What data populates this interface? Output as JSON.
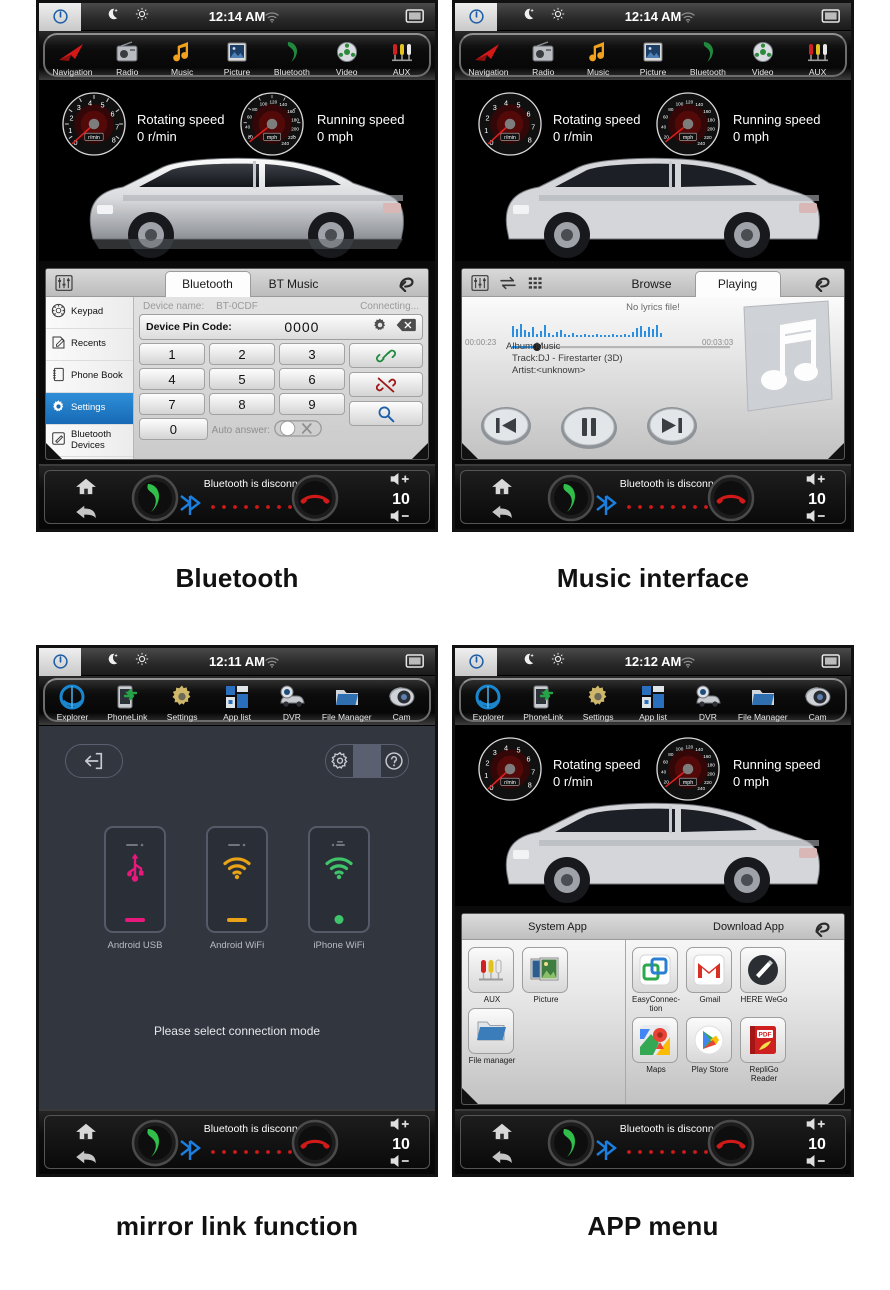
{
  "panels": [
    {
      "id": "bluetooth",
      "caption": "Bluetooth",
      "status": {
        "time": "12:14 AM",
        "power_icon": "power-icon",
        "moon_icon": "moon-icon",
        "brightness_icon": "brightness-icon",
        "wifi_icon": "wifi-icon",
        "display_icon": "display-icon"
      },
      "dock": [
        {
          "label": "Navigation",
          "icon": "navigation-icon"
        },
        {
          "label": "Radio",
          "icon": "radio-icon"
        },
        {
          "label": "Music",
          "icon": "music-note-icon"
        },
        {
          "label": "Picture",
          "icon": "picture-icon"
        },
        {
          "label": "Bluetooth",
          "icon": "bluetooth-phone-icon"
        },
        {
          "label": "Video",
          "icon": "video-icon"
        },
        {
          "label": "AUX",
          "icon": "aux-icon"
        }
      ],
      "gauges": {
        "tach_label": "Rotating speed",
        "tach_value": "0 r/min",
        "tach_unit": "r/min",
        "speedo_label": "Running speed",
        "speedo_value": "0 mph",
        "speedo_unit": "mph",
        "tach_ticks": [
          "0",
          "1",
          "2",
          "3",
          "4",
          "5",
          "6",
          "7",
          "8"
        ],
        "speedo_ticks": [
          "20",
          "40",
          "60",
          "80",
          "100",
          "120",
          "140",
          "160",
          "180",
          "200",
          "220",
          "240"
        ]
      },
      "overlay": {
        "tabs": [
          {
            "label": "Bluetooth",
            "active": true
          },
          {
            "label": "BT Music",
            "active": false
          }
        ],
        "tool_icon": "equalizer-icon",
        "back_icon": "back-arrow-icon",
        "sidebar": [
          {
            "label": "Keypad",
            "icon": "dialpad-icon",
            "selected": false
          },
          {
            "label": "Recents",
            "icon": "recents-icon",
            "selected": false
          },
          {
            "label": "Phone Book",
            "icon": "phonebook-icon",
            "selected": false
          },
          {
            "label": "Settings",
            "icon": "gear-icon",
            "selected": true
          },
          {
            "label": "Bluetooth Devices",
            "icon": "bt-devices-icon",
            "selected": false
          }
        ],
        "device_name_label": "Device name:",
        "device_name_value": "BT-0CDF",
        "connection_status": "Connecting...",
        "pin_label": "Device Pin Code:",
        "pin_value": "0000",
        "pin_gear_icon": "gear-icon",
        "pin_delete_icon": "backspace-icon",
        "keys": [
          [
            "1",
            "2",
            "3"
          ],
          [
            "4",
            "5",
            "6"
          ],
          [
            "7",
            "8",
            "9"
          ]
        ],
        "key_zero": "0",
        "auto_answer_label": "Auto answer:",
        "auto_answer_state": "off",
        "actions": [
          {
            "icon": "link-connect-icon"
          },
          {
            "icon": "link-disconnect-icon"
          },
          {
            "icon": "search-icon"
          }
        ]
      },
      "bottombar": {
        "home_icon": "home-icon",
        "back_icon": "back-arrow-icon",
        "call_icon": "call-answer-icon",
        "end_icon": "call-end-icon",
        "message": "Bluetooth is disconnected!",
        "bt_icon": "bluetooth-icon",
        "face_icon": "sad-face-icon",
        "vol_up_icon": "volume-up-icon",
        "vol_down_icon": "volume-down-icon",
        "volume": "10"
      }
    },
    {
      "id": "music",
      "caption": "Music interface",
      "status": {
        "time": "12:14 AM"
      },
      "overlay": {
        "tabs": [
          {
            "label": "Browse",
            "active": false
          },
          {
            "label": "Playing",
            "active": true
          }
        ],
        "tools": [
          "equalizer-icon",
          "repeat-icon",
          "playlist-icon"
        ],
        "back_icon": "back-arrow-icon",
        "no_lyrics": "No lyrics file!",
        "time_elapsed": "00:00:23",
        "time_total": "00:03:03",
        "album_line": "Album:Music",
        "track_line": "Track:DJ - Firestarter (3D)",
        "artist_line": "Artist:<unknown>",
        "album_art_icon": "music-note-icon",
        "controls": [
          {
            "icon": "previous-track-icon"
          },
          {
            "icon": "pause-icon"
          },
          {
            "icon": "next-track-icon"
          }
        ]
      }
    },
    {
      "id": "mirrorlink",
      "caption": "mirror link function",
      "status": {
        "time": "12:11 AM"
      },
      "dock": [
        {
          "label": "Explorer",
          "icon": "explorer-icon"
        },
        {
          "label": "PhoneLink",
          "icon": "phonelink-icon"
        },
        {
          "label": "Settings",
          "icon": "gear-icon"
        },
        {
          "label": "App list",
          "icon": "app-list-icon"
        },
        {
          "label": "DVR",
          "icon": "dvr-icon"
        },
        {
          "label": "File Manager",
          "icon": "folder-icon"
        },
        {
          "label": "Cam",
          "icon": "camera-icon"
        }
      ],
      "exit_icon": "exit-icon",
      "settings_icon": "gear-icon",
      "help_icon": "help-icon",
      "modes": [
        {
          "label": "Android USB",
          "icon": "usb-icon",
          "color": "#e8197d",
          "indicator": "bar"
        },
        {
          "label": "Android WiFi",
          "icon": "wifi-icon",
          "color": "#e8a317",
          "indicator": "bar"
        },
        {
          "label": "iPhone WiFi",
          "icon": "wifi-icon",
          "color": "#3fc46b",
          "indicator": "dot"
        }
      ],
      "hint": "Please select connection mode"
    },
    {
      "id": "appmenu",
      "caption": "APP menu",
      "status": {
        "time": "12:12 AM"
      },
      "overlay": {
        "left_title": "System App",
        "right_title": "Download App",
        "back_icon": "back-arrow-icon",
        "system_apps": [
          {
            "label": "AUX",
            "icon": "aux-icon"
          },
          {
            "label": "Picture",
            "icon": "picture-icon"
          },
          {
            "label": "File manager",
            "icon": "folder-icon"
          }
        ],
        "download_apps": [
          {
            "label": "EasyConnec-\ntion",
            "icon": "easyconnection-icon"
          },
          {
            "label": "Gmail",
            "icon": "gmail-icon"
          },
          {
            "label": "HERE WeGo",
            "icon": "here-wego-icon"
          },
          {
            "label": "Maps",
            "icon": "google-maps-icon"
          },
          {
            "label": "Play Store",
            "icon": "play-store-icon"
          },
          {
            "label": "RepliGo\nReader",
            "icon": "repligo-icon"
          }
        ]
      }
    }
  ],
  "colors": {
    "accent_blue": "#1769b5",
    "bt_blue": "#1b7fe0",
    "alert_red": "#d01a1a",
    "green_call": "#2fbf4a",
    "usb_pink": "#e8197d",
    "wifi_amber": "#e8a317",
    "wifi_green": "#3fc46b"
  }
}
